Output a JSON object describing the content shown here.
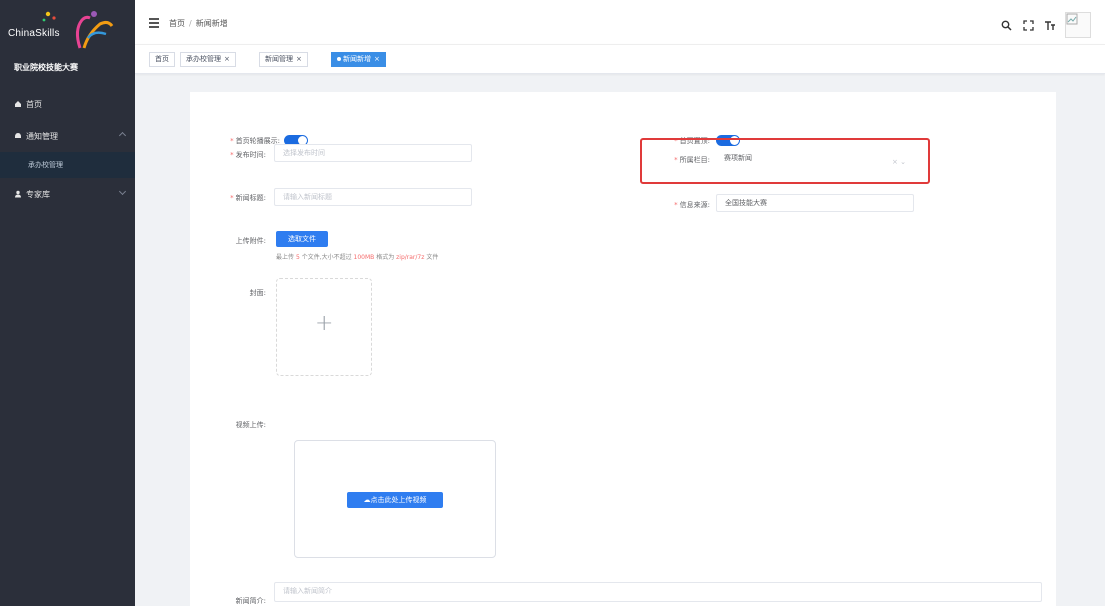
{
  "sidebar": {
    "logo_text": "ChinaSkills",
    "logo_subtitle": "职业院校技能大赛",
    "items": [
      {
        "label": "首页",
        "icon": "home-icon"
      },
      {
        "label": "通知管理",
        "icon": "bell-icon",
        "has_children": true
      },
      {
        "label": "专家库",
        "icon": "user-icon",
        "has_children": true
      }
    ],
    "subitems": [
      {
        "label": "承办校管理"
      }
    ]
  },
  "header": {
    "breadcrumb": [
      "首页",
      "新闻新增"
    ]
  },
  "tags": [
    {
      "label": "首页",
      "closable": false,
      "active": false
    },
    {
      "label": "承办校管理",
      "closable": true,
      "active": false
    },
    {
      "label": "新闻管理",
      "closable": true,
      "active": false
    },
    {
      "label": "新闻新增",
      "closable": true,
      "active": true
    }
  ],
  "form": {
    "show_switch_label": "首页轮播展示:",
    "top_switch_label": "首页置顶:",
    "publish_time_label": "发布时间:",
    "publish_time_placeholder": "选择发布时间",
    "column_label": "所属栏目:",
    "column_value": "赛项新闻",
    "news_title_label": "新闻标题:",
    "news_title_placeholder": "请输入新闻标题",
    "source_label": "信息来源:",
    "source_value": "全国技能大赛",
    "attachment_label": "上传附件:",
    "attachment_button": "选取文件",
    "attachment_hint_prefix": "最上传",
    "attachment_hint_mid": "个文件,大小不超过",
    "attachment_hint_limit": "100MB",
    "attachment_hint_suffix": "格式为",
    "attachment_hint_formats": "zip/rar/7z",
    "attachment_hint_end": "文件",
    "cover_label": "封面:",
    "video_label": "视频上传:",
    "video_button": "点击此处上传视频",
    "intro_label": "新闻简介:",
    "intro_placeholder": "请输入新闻简介"
  },
  "colors": {
    "sidebar_bg": "#2b2f3a",
    "primary": "#2f7df0",
    "highlight": "#e03a3a"
  }
}
